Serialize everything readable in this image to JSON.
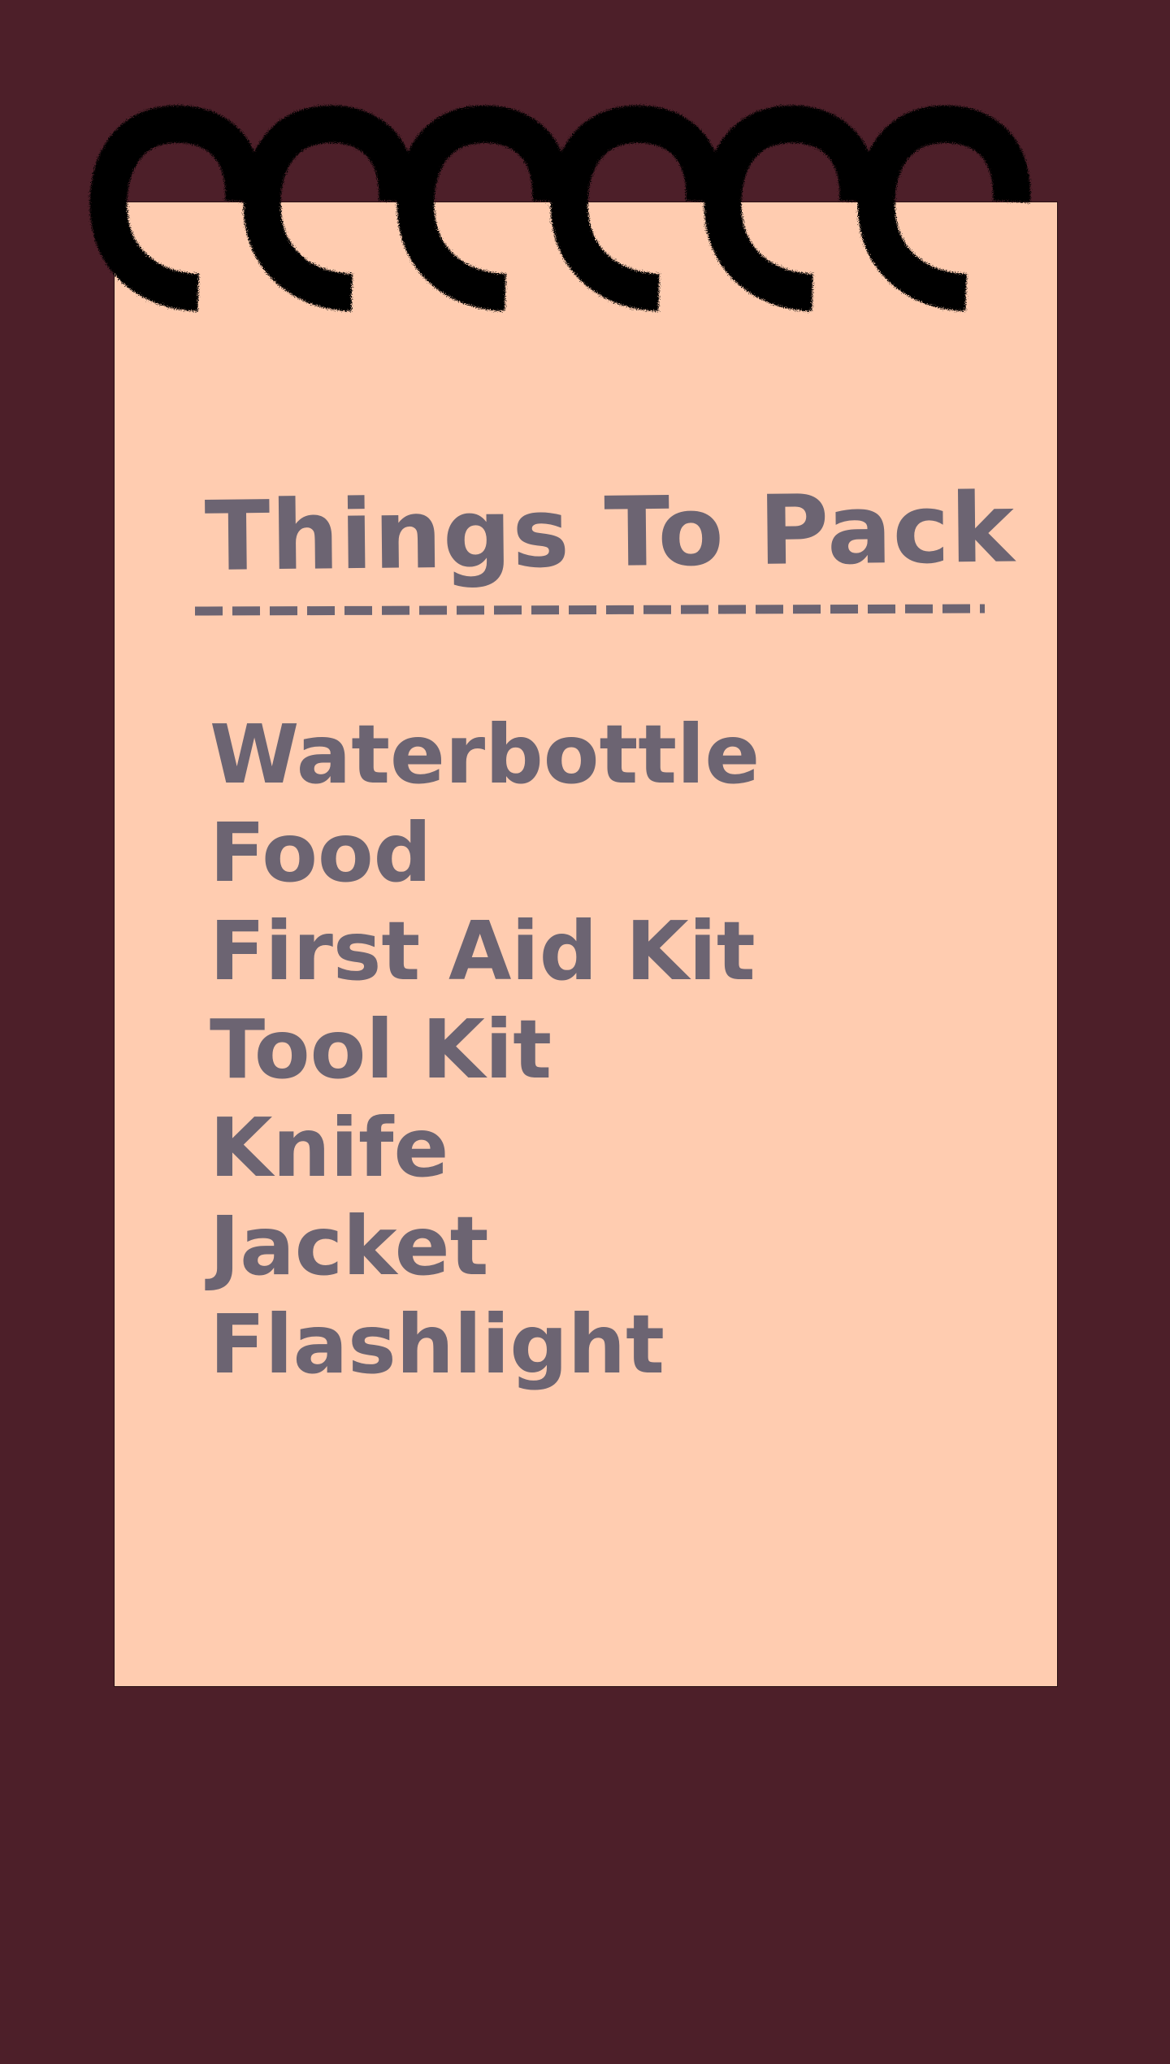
{
  "colors": {
    "background": "#4d1f29",
    "paper": "#ffccb0",
    "ink": "#6c6472",
    "binding_rings": "#050505"
  },
  "binding": {
    "icon": "spiral-ring-icon",
    "ring_count": 6
  },
  "note": {
    "title": "Things To Pack",
    "items": [
      "Waterbottle",
      "Food",
      "First Aid Kit",
      "Tool Kit",
      "Knife",
      "Jacket",
      "Flashlight"
    ]
  }
}
